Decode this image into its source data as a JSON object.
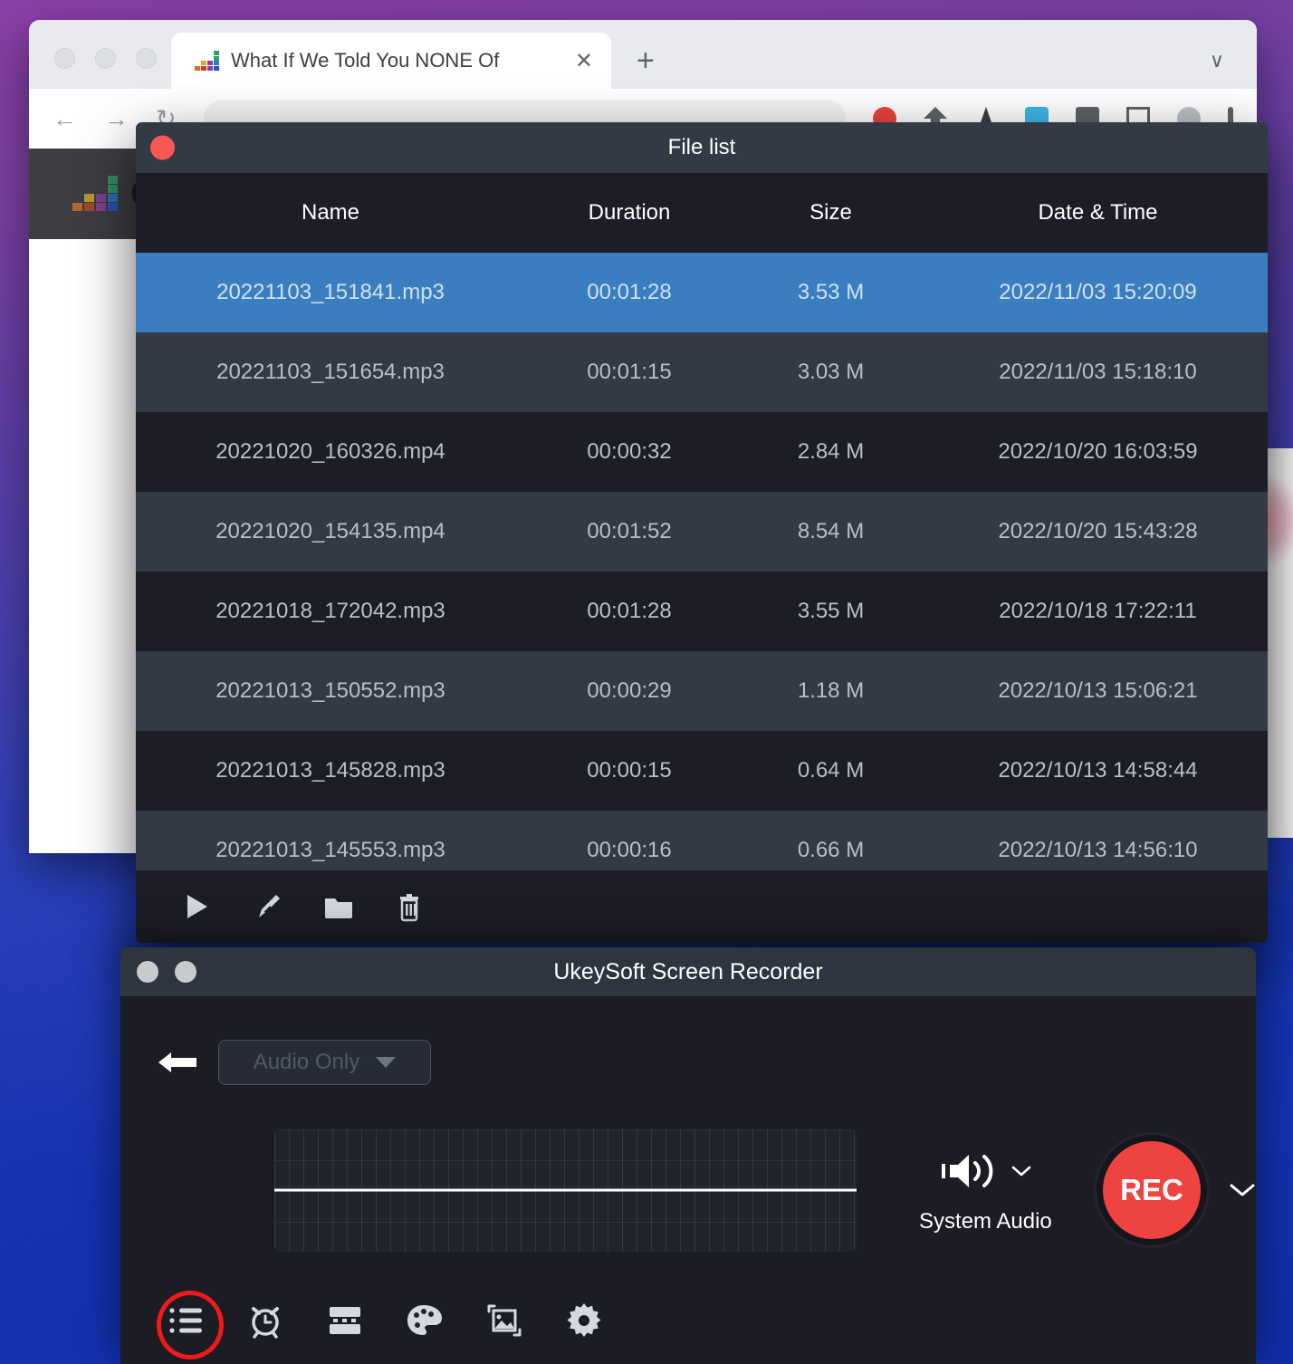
{
  "desktop": {
    "background_top_color": "#8b3fa8",
    "background_bottom_color": "#0f2ea8"
  },
  "browser": {
    "tab": {
      "title": "What If We Told You NONE Of",
      "close_label": "✕",
      "favicon_name": "equalizer-favicon"
    },
    "new_tab_label": "+",
    "tab_list_chevron": "∨",
    "back_label": "←",
    "forward_label": "→",
    "reload_label": "↻",
    "omnibox_value": "",
    "page": {
      "logo_text": "C",
      "player_prev_label": "◀"
    }
  },
  "file_list": {
    "window_title": "File list",
    "close_button_label": "",
    "columns": [
      "Name",
      "Duration",
      "Size",
      "Date & Time"
    ],
    "rows": [
      {
        "name": "20221103_151841.mp3",
        "duration": "00:01:28",
        "size": "3.53 M",
        "datetime": "2022/11/03 15:20:09",
        "selected": true
      },
      {
        "name": "20221103_151654.mp3",
        "duration": "00:01:15",
        "size": "3.03 M",
        "datetime": "2022/11/03 15:18:10",
        "selected": false
      },
      {
        "name": "20221020_160326.mp4",
        "duration": "00:00:32",
        "size": "2.84 M",
        "datetime": "2022/10/20 16:03:59",
        "selected": false
      },
      {
        "name": "20221020_154135.mp4",
        "duration": "00:01:52",
        "size": "8.54 M",
        "datetime": "2022/10/20 15:43:28",
        "selected": false
      },
      {
        "name": "20221018_172042.mp3",
        "duration": "00:01:28",
        "size": "3.55 M",
        "datetime": "2022/10/18 17:22:11",
        "selected": false
      },
      {
        "name": "20221013_150552.mp3",
        "duration": "00:00:29",
        "size": "1.18 M",
        "datetime": "2022/10/13 15:06:21",
        "selected": false
      },
      {
        "name": "20221013_145828.mp3",
        "duration": "00:00:15",
        "size": "0.64 M",
        "datetime": "2022/10/13 14:58:44",
        "selected": false
      },
      {
        "name": "20221013_145553.mp3",
        "duration": "00:00:16",
        "size": "0.66 M",
        "datetime": "2022/10/13 14:56:10",
        "selected": false
      }
    ],
    "toolbar": [
      {
        "icon": "play-icon",
        "label": "Play"
      },
      {
        "icon": "brush-icon",
        "label": "Edit"
      },
      {
        "icon": "folder-icon",
        "label": "Show in folder"
      },
      {
        "icon": "trash-icon",
        "label": "Delete"
      }
    ],
    "selection_color": "#3a7ebf",
    "row_alt_color": "#333a45",
    "row_color": "#1c1d26"
  },
  "recorder": {
    "window_title": "UkeySoft Screen Recorder",
    "back_label": "←",
    "mode": {
      "value": "Audio Only",
      "chevron": "▼"
    },
    "audio_source": {
      "label": "System Audio",
      "icon": "speaker-icon",
      "chevron": "∨"
    },
    "record": {
      "label": "REC",
      "color": "#ee4340",
      "chevron": "∨"
    },
    "bottom_toolbar": [
      {
        "icon": "list-icon",
        "label": "File list",
        "highlighted": true
      },
      {
        "icon": "alarm-clock-icon",
        "label": "Scheduled recording",
        "highlighted": false
      },
      {
        "icon": "trim-icon",
        "label": "Trim",
        "highlighted": false
      },
      {
        "icon": "palette-icon",
        "label": "Annotation",
        "highlighted": false
      },
      {
        "icon": "image-icon",
        "label": "Watermark",
        "highlighted": false
      },
      {
        "icon": "gear-icon",
        "label": "Settings",
        "highlighted": false
      }
    ]
  }
}
